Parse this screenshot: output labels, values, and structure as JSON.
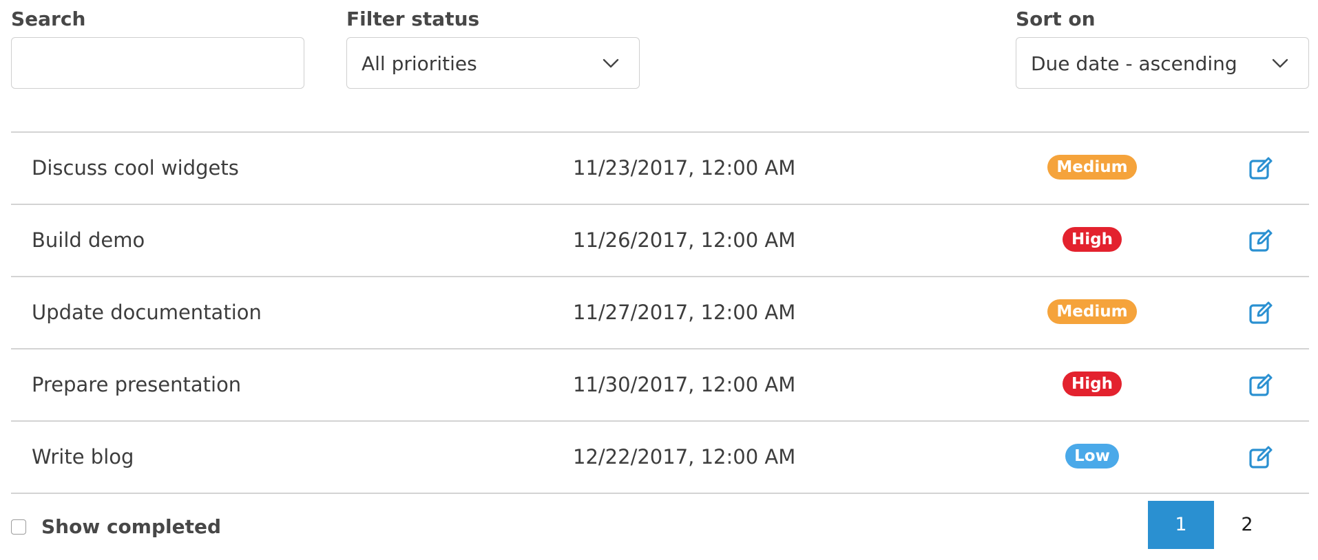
{
  "filters": {
    "search": {
      "label": "Search",
      "value": ""
    },
    "status": {
      "label": "Filter status",
      "value": "All priorities"
    },
    "sort": {
      "label": "Sort on",
      "value": "Due date - ascending"
    }
  },
  "tasks": [
    {
      "name": "Discuss cool widgets",
      "due": "11/23/2017, 12:00 AM",
      "priority": "Medium",
      "priority_color": "#f5a33b",
      "edit_icon": "edit-icon"
    },
    {
      "name": "Build demo",
      "due": "11/26/2017, 12:00 AM",
      "priority": "High",
      "priority_color": "#e3222e",
      "edit_icon": "edit-icon"
    },
    {
      "name": "Update documentation",
      "due": "11/27/2017, 12:00 AM",
      "priority": "Medium",
      "priority_color": "#f5a33b",
      "edit_icon": "edit-icon"
    },
    {
      "name": "Prepare presentation",
      "due": "11/30/2017, 12:00 AM",
      "priority": "High",
      "priority_color": "#e3222e",
      "edit_icon": "edit-icon"
    },
    {
      "name": "Write blog",
      "due": "12/22/2017, 12:00 AM",
      "priority": "Low",
      "priority_color": "#4aa9e9",
      "edit_icon": "edit-icon"
    }
  ],
  "footer": {
    "show_completed": {
      "label": "Show completed",
      "checked": false
    },
    "pagination": {
      "pages": [
        "1",
        "2"
      ],
      "current": "1",
      "active_color": "#2a90d1"
    }
  },
  "colors": {
    "accent": "#2a90d1",
    "edit_icon": "#2a90d1"
  }
}
